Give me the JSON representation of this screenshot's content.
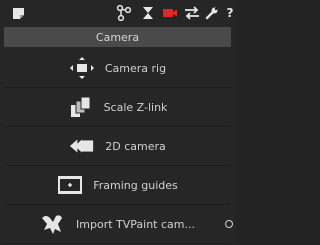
{
  "header": {
    "title": "Camera"
  },
  "toolbar": {
    "icons": [
      "note-icon",
      "node-graph-icon",
      "hourglass-icon",
      "camera-icon",
      "swap-arrows-icon",
      "wrench-icon",
      "help-icon"
    ],
    "help_label": "?",
    "active_color": "#e02828"
  },
  "items": [
    {
      "label": "Camera rig",
      "icon": "camera-rig-icon"
    },
    {
      "label": "Scale Z-link",
      "icon": "scale-zlink-icon"
    },
    {
      "label": "2D camera",
      "icon": "2d-camera-icon"
    },
    {
      "label": "Framing guides",
      "icon": "framing-guides-icon"
    },
    {
      "label": "Import TVPaint cam...",
      "icon": "tvpaint-import-icon"
    }
  ]
}
